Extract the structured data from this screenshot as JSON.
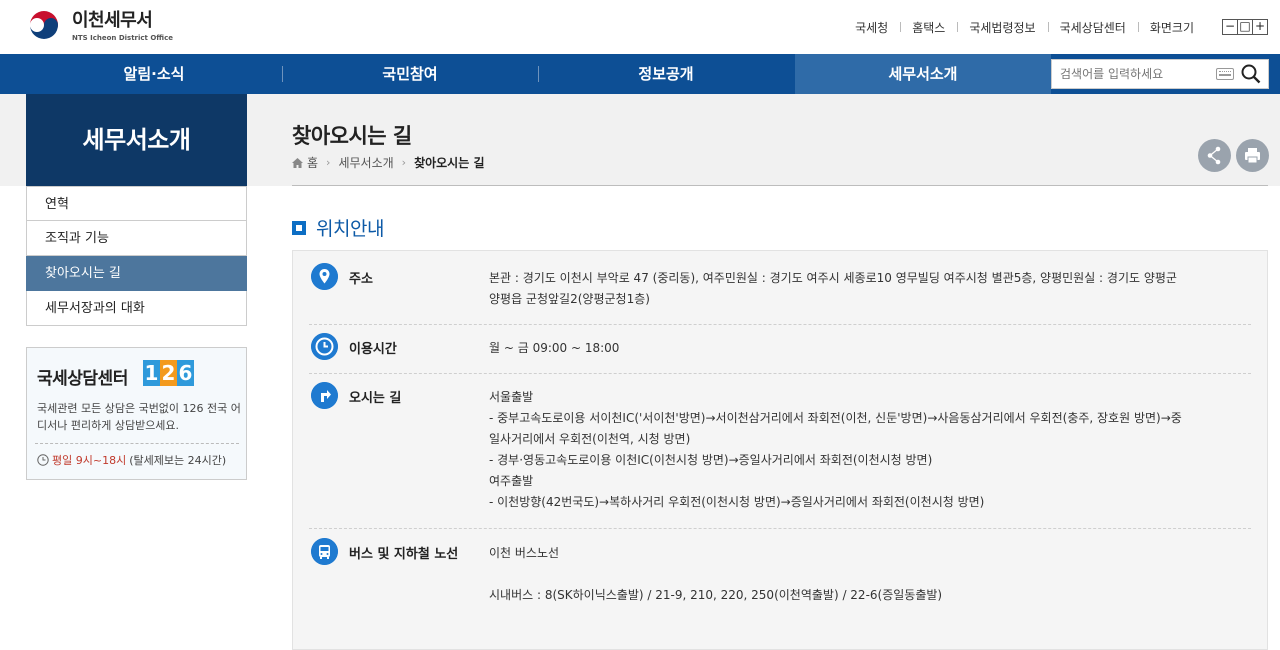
{
  "header": {
    "logo_title": "이천세무서",
    "logo_sub": "NTS Icheon District Office",
    "links": [
      "국세청",
      "홈택스",
      "국세법령정보",
      "국세상담센터",
      "화면크기"
    ],
    "zoom": [
      "−",
      "□",
      "+"
    ]
  },
  "gnb": {
    "items": [
      "알림·소식",
      "국민참여",
      "정보공개",
      "세무서소개"
    ],
    "search_placeholder": "검색어를 입력하세요"
  },
  "lnb": {
    "title": "세무서소개",
    "items": [
      "연혁",
      "조직과 기능",
      "찾아오시는 길",
      "세무서장과의 대화"
    ]
  },
  "callcenter": {
    "title": "국세상담센터",
    "number": [
      "1",
      "2",
      "6"
    ],
    "number_colors": [
      "#2f9adb",
      "#f39a1e",
      "#2f9adb"
    ],
    "desc": "국세관련 모든 상담은 국번없이 126 전국 어디서나 편리하게 상담받으세요.",
    "time_red": "평일 9시~18시",
    "time_rest": "(탈세제보는 24시간)"
  },
  "page": {
    "title": "찾아오시는 길",
    "breadcrumb": [
      "홈",
      "세무서소개",
      "찾아오시는 길"
    ]
  },
  "section": {
    "title": "위치안내",
    "rows": [
      {
        "icon": "location-pin-icon",
        "label": "주소",
        "lines": [
          "본관 : 경기도 이천시 부악로 47 (중리동), 여주민원실 : 경기도 여주시 세종로10 영무빌딩 여주시청 별관5층, 양평민원실 : 경기도 양평군",
          "양평읍 군청앞길2(양평군청1층)"
        ]
      },
      {
        "icon": "clock-icon",
        "label": "이용시간",
        "lines": [
          "월 ~ 금 09:00 ~ 18:00"
        ]
      },
      {
        "icon": "direction-sign-icon",
        "label": "오시는 길",
        "lines": [
          "서울출발",
          "- 중부고속도로이용 서이천IC('서이천'방면)→서이천삼거리에서 좌회전(이천, 신둔'방면)→사음동삼거리에서 우회전(충주, 장호원 방면)→중",
          "일사거리에서 우회전(이천역, 시청 방면)",
          "- 경부·영동고속도로이용 이천IC(이천시청 방면)→증일사거리에서 좌회전(이천시청 방면)",
          "여주출발",
          "- 이천방향(42번국도)→복하사거리 우회전(이천시청 방면)→증일사거리에서 좌회전(이천시청 방면)"
        ]
      },
      {
        "icon": "bus-icon",
        "label": "버스 및 지하철 노선",
        "lines": [
          "이천 버스노선",
          "",
          "시내버스 : 8(SK하이닉스출발) / 21-9, 210, 220, 250(이천역출발) / 22-6(증일동출발)"
        ]
      }
    ]
  },
  "colors": {
    "gnb": "#0d4f95",
    "gnb_active": "#2f6ba8",
    "lnb_title": "#0e3866",
    "lnb_active": "#4d769d",
    "accent": "#1f7ad0"
  }
}
